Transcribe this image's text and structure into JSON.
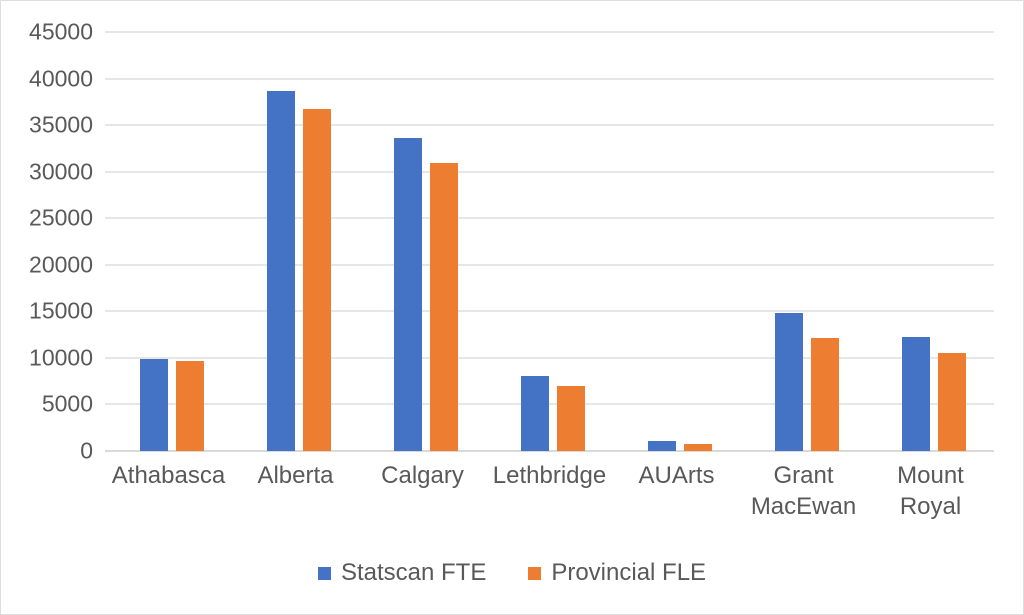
{
  "chart_data": {
    "type": "bar",
    "title": "",
    "subtitle": "",
    "xlabel": "",
    "ylabel": "",
    "ylim": [
      0,
      45000
    ],
    "ytick_step": 5000,
    "yticks": [
      45000,
      40000,
      35000,
      30000,
      25000,
      20000,
      15000,
      10000,
      5000,
      0
    ],
    "ytick_labels": [
      "45000",
      "40000",
      "35000",
      "30000",
      "25000",
      "20000",
      "15000",
      "10000",
      "5000",
      "0"
    ],
    "grid": true,
    "legend_position": "bottom",
    "categories": [
      "Athabasca",
      "Alberta",
      "Calgary",
      "Lethbridge",
      "AUArts",
      "Grant\nMacEwan",
      "Mount\nRoyal"
    ],
    "series": [
      {
        "name": "Statscan FTE",
        "color": "#4472C4",
        "values": [
          9880,
          38700,
          33620,
          8060,
          1070,
          14830,
          12250
        ]
      },
      {
        "name": "Provincial FLE",
        "color": "#ED7D31",
        "values": [
          9670,
          36750,
          30930,
          6980,
          750,
          12140,
          10530
        ]
      }
    ]
  },
  "legend": {
    "entries": [
      {
        "label": "Statscan FTE",
        "color": "#4472C4"
      },
      {
        "label": "Provincial FLE",
        "color": "#ED7D31"
      }
    ]
  },
  "colors": {
    "series_blue": "#4472C4",
    "series_orange": "#ED7D31",
    "gridline": "#E6E6E6",
    "text": "#595959",
    "border": "#DEDEDE",
    "background": "#FFFFFF"
  }
}
